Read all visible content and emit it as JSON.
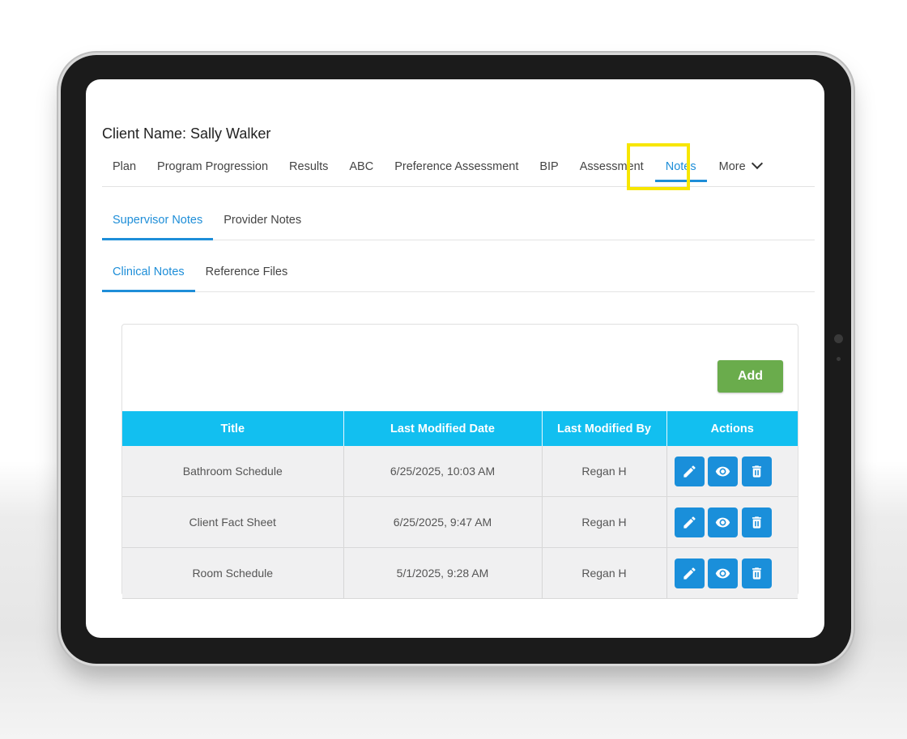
{
  "client": {
    "label": "Client Name: Sally Walker"
  },
  "main_tabs": [
    {
      "label": "Plan"
    },
    {
      "label": "Program Progression"
    },
    {
      "label": "Results"
    },
    {
      "label": "ABC"
    },
    {
      "label": "Preference Assessment"
    },
    {
      "label": "BIP"
    },
    {
      "label": "Assessment"
    },
    {
      "label": "Notes",
      "active": true
    },
    {
      "label": "More",
      "icon": "chevron-down-icon"
    }
  ],
  "sub_tabs": [
    {
      "label": "Supervisor Notes",
      "active": true
    },
    {
      "label": "Provider Notes"
    }
  ],
  "sub_tabs2": [
    {
      "label": "Clinical Notes",
      "active": true
    },
    {
      "label": "Reference Files"
    }
  ],
  "card": {
    "add_label": "Add",
    "columns": [
      "Title",
      "Last Modified Date",
      "Last Modified By",
      "Actions"
    ],
    "rows": [
      {
        "title": "Bathroom Schedule",
        "date": "6/25/2025, 10:03 AM",
        "by": "Regan H"
      },
      {
        "title": "Client Fact Sheet",
        "date": "6/25/2025, 9:47 AM",
        "by": "Regan H"
      },
      {
        "title": "Room Schedule",
        "date": "5/1/2025, 9:28 AM",
        "by": "Regan H"
      }
    ],
    "actions": [
      {
        "name": "edit",
        "icon": "pencil-icon"
      },
      {
        "name": "view",
        "icon": "eye-icon"
      },
      {
        "name": "delete",
        "icon": "trash-icon"
      }
    ]
  },
  "colors": {
    "accent": "#1e8ed8",
    "header": "#12bff0",
    "add_button": "#6aac4c",
    "highlight": "#f7e600"
  }
}
